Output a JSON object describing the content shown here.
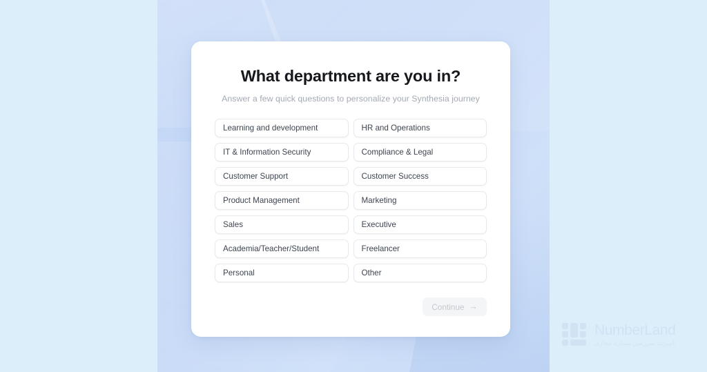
{
  "page": {
    "title": "What department are you in?",
    "subtitle": "Answer a few quick questions to personalize your Synthesia journey"
  },
  "options": [
    {
      "label": "Learning and development"
    },
    {
      "label": "HR and Operations"
    },
    {
      "label": "IT & Information Security"
    },
    {
      "label": "Compliance & Legal"
    },
    {
      "label": "Customer Support"
    },
    {
      "label": "Customer Success"
    },
    {
      "label": "Product Management"
    },
    {
      "label": "Marketing"
    },
    {
      "label": "Sales"
    },
    {
      "label": "Executive"
    },
    {
      "label": "Academia/Teacher/Student"
    },
    {
      "label": "Freelancer"
    },
    {
      "label": "Personal"
    },
    {
      "label": "Other"
    }
  ],
  "footer": {
    "continue_label": "Continue",
    "continue_arrow": "→",
    "continue_enabled": false
  },
  "watermark": {
    "wordmark": "NumberLand",
    "tagline": "نامبرلند سرزمین شماره مجازی"
  },
  "colors": {
    "card_background": "#ffffff",
    "panel_blue": "#c6d9f6",
    "outer_band": "#ddeefb",
    "title_text": "#16181d",
    "subtitle_text": "#a3a9b3",
    "option_border": "#e7e9ec",
    "option_text": "#3d4450",
    "continue_background": "#f4f5f7",
    "continue_text": "#c4c8ce",
    "watermark": "#c8d8ee"
  }
}
